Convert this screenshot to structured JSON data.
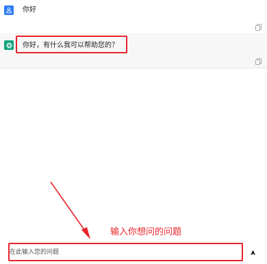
{
  "conversation": {
    "messages": [
      {
        "role": "user",
        "text": "你好",
        "avatar_icon": "user-avatar-icon",
        "action_icon": "copy-icon"
      },
      {
        "role": "assistant",
        "text": "你好，有什么我可以帮助您的？",
        "avatar_icon": "openai-logo-icon",
        "action_icon": "copy-icon"
      }
    ]
  },
  "annotation": {
    "text": "输入你想问的问题",
    "color": "#e8232a"
  },
  "composer": {
    "placeholder": "在此输入您的问题",
    "value": "",
    "send_icon": "send-arrow-icon"
  },
  "colors": {
    "user_avatar": "#2f7cf6",
    "assistant_avatar": "#10a37f",
    "highlight": "#e8232a",
    "assistant_bg": "#f7f7f8"
  }
}
